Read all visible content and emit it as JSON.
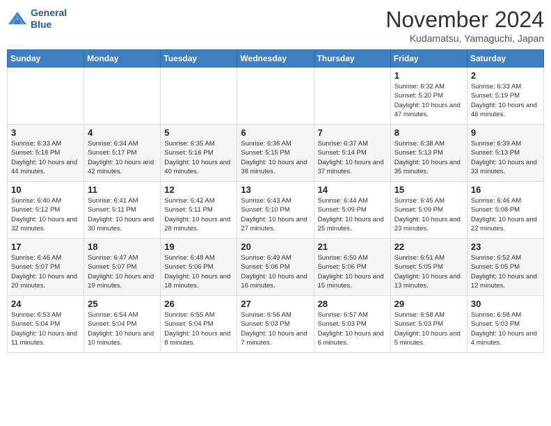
{
  "header": {
    "logo_line1": "General",
    "logo_line2": "Blue",
    "month_title": "November 2024",
    "location": "Kudamatsu, Yamaguchi, Japan"
  },
  "weekdays": [
    "Sunday",
    "Monday",
    "Tuesday",
    "Wednesday",
    "Thursday",
    "Friday",
    "Saturday"
  ],
  "weeks": [
    [
      {
        "day": "",
        "detail": ""
      },
      {
        "day": "",
        "detail": ""
      },
      {
        "day": "",
        "detail": ""
      },
      {
        "day": "",
        "detail": ""
      },
      {
        "day": "",
        "detail": ""
      },
      {
        "day": "1",
        "detail": "Sunrise: 6:32 AM\nSunset: 5:20 PM\nDaylight: 10 hours\nand 47 minutes."
      },
      {
        "day": "2",
        "detail": "Sunrise: 6:33 AM\nSunset: 5:19 PM\nDaylight: 10 hours\nand 46 minutes."
      }
    ],
    [
      {
        "day": "3",
        "detail": "Sunrise: 6:33 AM\nSunset: 5:18 PM\nDaylight: 10 hours\nand 44 minutes."
      },
      {
        "day": "4",
        "detail": "Sunrise: 6:34 AM\nSunset: 5:17 PM\nDaylight: 10 hours\nand 42 minutes."
      },
      {
        "day": "5",
        "detail": "Sunrise: 6:35 AM\nSunset: 5:16 PM\nDaylight: 10 hours\nand 40 minutes."
      },
      {
        "day": "6",
        "detail": "Sunrise: 6:36 AM\nSunset: 5:15 PM\nDaylight: 10 hours\nand 38 minutes."
      },
      {
        "day": "7",
        "detail": "Sunrise: 6:37 AM\nSunset: 5:14 PM\nDaylight: 10 hours\nand 37 minutes."
      },
      {
        "day": "8",
        "detail": "Sunrise: 6:38 AM\nSunset: 5:13 PM\nDaylight: 10 hours\nand 35 minutes."
      },
      {
        "day": "9",
        "detail": "Sunrise: 6:39 AM\nSunset: 5:13 PM\nDaylight: 10 hours\nand 33 minutes."
      }
    ],
    [
      {
        "day": "10",
        "detail": "Sunrise: 6:40 AM\nSunset: 5:12 PM\nDaylight: 10 hours\nand 32 minutes."
      },
      {
        "day": "11",
        "detail": "Sunrise: 6:41 AM\nSunset: 5:11 PM\nDaylight: 10 hours\nand 30 minutes."
      },
      {
        "day": "12",
        "detail": "Sunrise: 6:42 AM\nSunset: 5:11 PM\nDaylight: 10 hours\nand 28 minutes."
      },
      {
        "day": "13",
        "detail": "Sunrise: 6:43 AM\nSunset: 5:10 PM\nDaylight: 10 hours\nand 27 minutes."
      },
      {
        "day": "14",
        "detail": "Sunrise: 6:44 AM\nSunset: 5:09 PM\nDaylight: 10 hours\nand 25 minutes."
      },
      {
        "day": "15",
        "detail": "Sunrise: 6:45 AM\nSunset: 5:09 PM\nDaylight: 10 hours\nand 23 minutes."
      },
      {
        "day": "16",
        "detail": "Sunrise: 6:46 AM\nSunset: 5:08 PM\nDaylight: 10 hours\nand 22 minutes."
      }
    ],
    [
      {
        "day": "17",
        "detail": "Sunrise: 6:46 AM\nSunset: 5:07 PM\nDaylight: 10 hours\nand 20 minutes."
      },
      {
        "day": "18",
        "detail": "Sunrise: 6:47 AM\nSunset: 5:07 PM\nDaylight: 10 hours\nand 19 minutes."
      },
      {
        "day": "19",
        "detail": "Sunrise: 6:48 AM\nSunset: 5:06 PM\nDaylight: 10 hours\nand 18 minutes."
      },
      {
        "day": "20",
        "detail": "Sunrise: 6:49 AM\nSunset: 5:06 PM\nDaylight: 10 hours\nand 16 minutes."
      },
      {
        "day": "21",
        "detail": "Sunrise: 6:50 AM\nSunset: 5:06 PM\nDaylight: 10 hours\nand 15 minutes."
      },
      {
        "day": "22",
        "detail": "Sunrise: 6:51 AM\nSunset: 5:05 PM\nDaylight: 10 hours\nand 13 minutes."
      },
      {
        "day": "23",
        "detail": "Sunrise: 6:52 AM\nSunset: 5:05 PM\nDaylight: 10 hours\nand 12 minutes."
      }
    ],
    [
      {
        "day": "24",
        "detail": "Sunrise: 6:53 AM\nSunset: 5:04 PM\nDaylight: 10 hours\nand 11 minutes."
      },
      {
        "day": "25",
        "detail": "Sunrise: 6:54 AM\nSunset: 5:04 PM\nDaylight: 10 hours\nand 10 minutes."
      },
      {
        "day": "26",
        "detail": "Sunrise: 6:55 AM\nSunset: 5:04 PM\nDaylight: 10 hours\nand 8 minutes."
      },
      {
        "day": "27",
        "detail": "Sunrise: 6:56 AM\nSunset: 5:03 PM\nDaylight: 10 hours\nand 7 minutes."
      },
      {
        "day": "28",
        "detail": "Sunrise: 6:57 AM\nSunset: 5:03 PM\nDaylight: 10 hours\nand 6 minutes."
      },
      {
        "day": "29",
        "detail": "Sunrise: 6:58 AM\nSunset: 5:03 PM\nDaylight: 10 hours\nand 5 minutes."
      },
      {
        "day": "30",
        "detail": "Sunrise: 6:58 AM\nSunset: 5:03 PM\nDaylight: 10 hours\nand 4 minutes."
      }
    ]
  ]
}
